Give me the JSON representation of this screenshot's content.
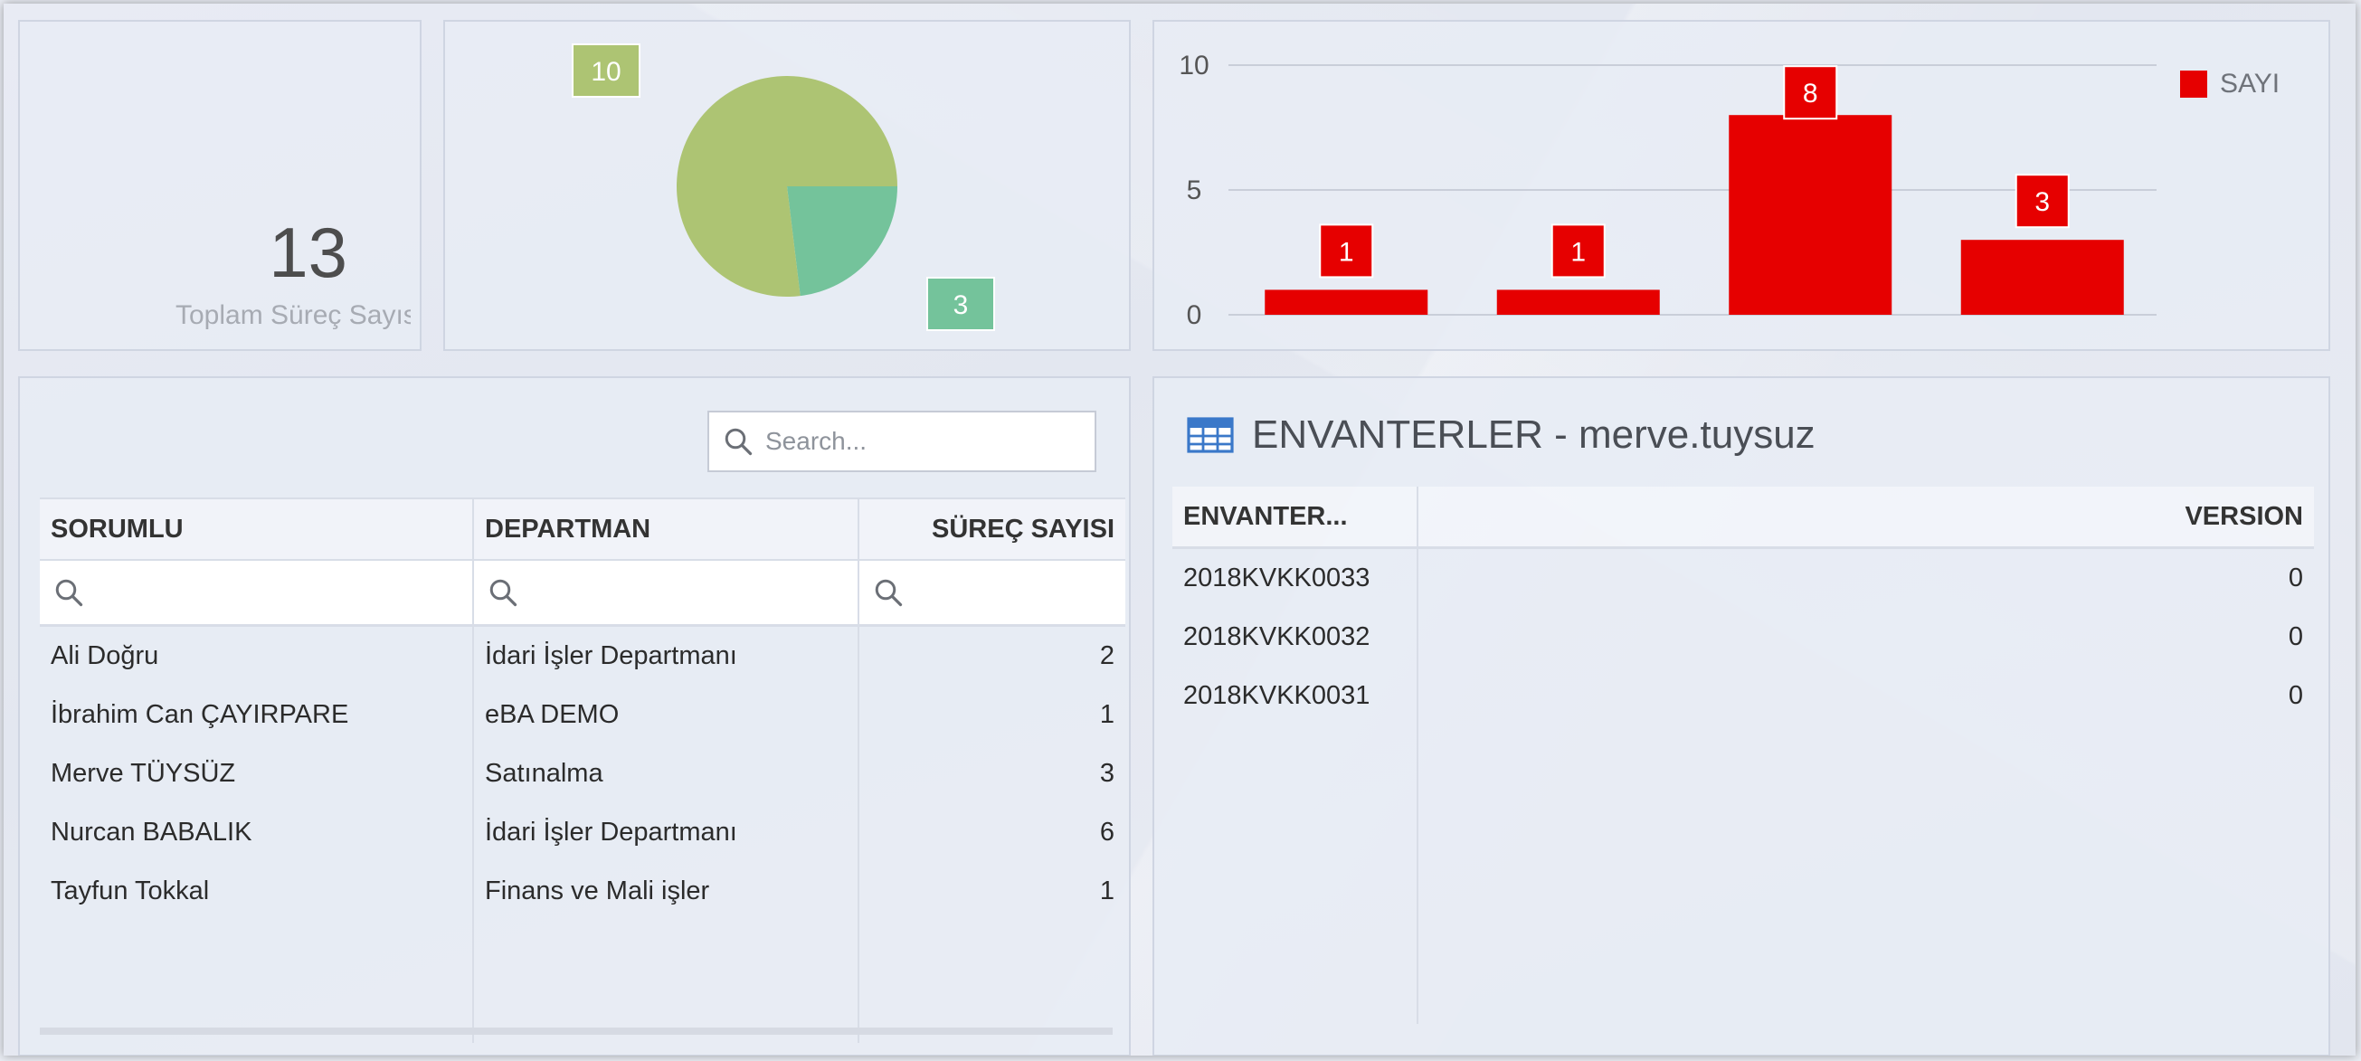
{
  "kpi": {
    "value": "13",
    "label": "Toplam Süreç Sayısı"
  },
  "pie": {
    "slices": [
      {
        "label": "10",
        "value": 10,
        "color": "#adc473"
      },
      {
        "label": "3",
        "value": 3,
        "color": "#74c39b"
      }
    ]
  },
  "chart_data": {
    "type": "bar",
    "categories": [
      "",
      "",
      "",
      ""
    ],
    "series": [
      {
        "name": "SAYI",
        "values": [
          1,
          1,
          8,
          3
        ]
      }
    ],
    "ylim": [
      0,
      10
    ],
    "yticks": [
      0,
      5,
      10
    ],
    "legend": "top-right",
    "grid": true,
    "color": "#e60000"
  },
  "responsible_table": {
    "search_placeholder": "Search...",
    "columns": [
      "SORUMLU",
      "DEPARTMAN",
      "SÜREÇ SAYISI"
    ],
    "rows": [
      [
        "Ali Doğru",
        "İdari İşler Departmanı",
        "2"
      ],
      [
        "İbrahim Can ÇAYIRPARE",
        "eBA DEMO",
        "1"
      ],
      [
        "Merve TÜYSÜZ",
        "Satınalma",
        "3"
      ],
      [
        "Nurcan BABALIK",
        "İdari İşler Departmanı",
        "6"
      ],
      [
        "Tayfun Tokkal",
        "Finans ve Mali işler",
        "1"
      ]
    ]
  },
  "inventory": {
    "title": "ENVANTERLER - merve.tuysuz",
    "columns": [
      "ENVANTER...",
      "VERSION"
    ],
    "rows": [
      [
        "2018KVKK0033",
        "0"
      ],
      [
        "2018KVKK0032",
        "0"
      ],
      [
        "2018KVKK0031",
        "0"
      ]
    ]
  }
}
